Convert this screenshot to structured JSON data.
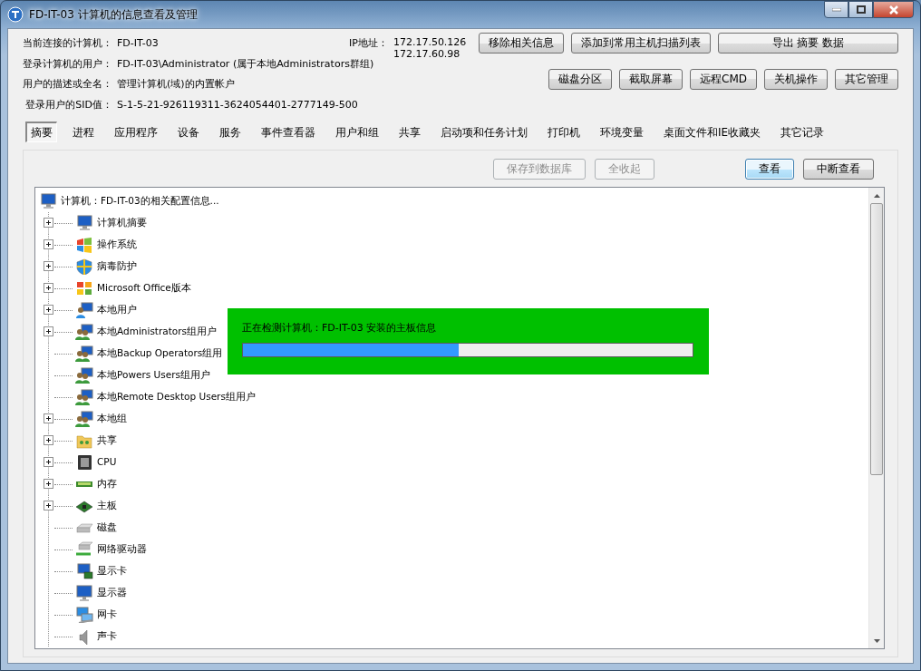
{
  "window": {
    "title": "FD-IT-03 计算机的信息查看及管理"
  },
  "info": [
    {
      "label": "当前连接的计算机：",
      "value": "FD-IT-03"
    },
    {
      "label": "登录计算机的用户：",
      "value": "FD-IT-03\\Administrator (属于本地Administrators群组)"
    },
    {
      "label": "用户的描述或全名：",
      "value": "管理计算机(域)的内置帐户"
    },
    {
      "label": "登录用户的SID值：",
      "value": "S-1-5-21-926119311-3624054401-2777149-500"
    }
  ],
  "ip": {
    "label": "IP地址：",
    "values": [
      "172.17.50.126",
      "172.17.60.98"
    ]
  },
  "top_buttons": [
    "移除相关信息",
    "添加到常用主机扫描列表",
    "导出 摘要 数据"
  ],
  "tool_buttons": [
    "磁盘分区",
    "截取屏幕",
    "远程CMD",
    "关机操作",
    "其它管理"
  ],
  "tabs": [
    {
      "label": "摘要",
      "selected": true
    },
    {
      "label": "进程",
      "selected": false
    },
    {
      "label": "应用程序",
      "selected": false
    },
    {
      "label": "设备",
      "selected": false
    },
    {
      "label": "服务",
      "selected": false
    },
    {
      "label": "事件查看器",
      "selected": false
    },
    {
      "label": "用户和组",
      "selected": false
    },
    {
      "label": "共享",
      "selected": false
    },
    {
      "label": "启动项和任务计划",
      "selected": false
    },
    {
      "label": "打印机",
      "selected": false
    },
    {
      "label": "环境变量",
      "selected": false
    },
    {
      "label": "桌面文件和IE收藏夹",
      "selected": false
    },
    {
      "label": "其它记录",
      "selected": false
    }
  ],
  "actions": [
    {
      "label": "保存到数据库",
      "disabled": true,
      "default": false
    },
    {
      "label": "全收起",
      "disabled": true,
      "default": false
    },
    {
      "label": "查看",
      "disabled": false,
      "default": true
    },
    {
      "label": "中断查看",
      "disabled": false,
      "default": false
    }
  ],
  "tree": {
    "root": "计算机：FD-IT-03的相关配置信息...",
    "items": [
      {
        "label": "计算机摘要",
        "has_children": true
      },
      {
        "label": "操作系统",
        "has_children": true
      },
      {
        "label": "病毒防护",
        "has_children": true
      },
      {
        "label": "Microsoft Office版本",
        "has_children": true
      },
      {
        "label": "本地用户",
        "has_children": true
      },
      {
        "label": "本地Administrators组用户",
        "has_children": true
      },
      {
        "label": "本地Backup Operators组用",
        "has_children": false
      },
      {
        "label": "本地Powers Users组用户",
        "has_children": false
      },
      {
        "label": "本地Remote Desktop Users组用户",
        "has_children": false
      },
      {
        "label": "本地组",
        "has_children": true
      },
      {
        "label": "共享",
        "has_children": true
      },
      {
        "label": "CPU",
        "has_children": true
      },
      {
        "label": "内存",
        "has_children": true
      },
      {
        "label": "主板",
        "has_children": true
      },
      {
        "label": "磁盘",
        "has_children": false
      },
      {
        "label": "网络驱动器",
        "has_children": false
      },
      {
        "label": "显示卡",
        "has_children": false
      },
      {
        "label": "显示器",
        "has_children": false
      },
      {
        "label": "网卡",
        "has_children": false
      },
      {
        "label": "声卡",
        "has_children": false
      }
    ]
  },
  "progress": {
    "message": "正在检测计算机：FD-IT-03 安装的主板信息",
    "level": 0.48
  }
}
